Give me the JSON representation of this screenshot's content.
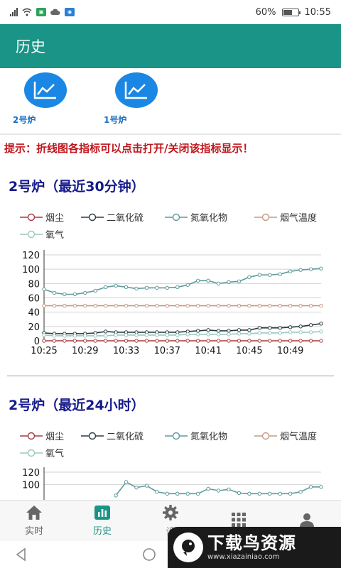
{
  "status_bar": {
    "battery_percent": "60%",
    "time": "10:55",
    "battery_level": 0.6
  },
  "header": {
    "title": "历史"
  },
  "furnaces": [
    {
      "label": "2号炉",
      "icon": "line-chart-icon"
    },
    {
      "label": "1号炉",
      "icon": "line-chart-icon"
    }
  ],
  "tip": "提示：折线图各指标可以点击打开/关闭该指标显示！",
  "legend_items": [
    {
      "label": "烟尘",
      "color": "#a63a43"
    },
    {
      "label": "二氧化硫",
      "color": "#2b3a42"
    },
    {
      "label": "氮氧化物",
      "color": "#5f9a9d"
    },
    {
      "label": "烟气温度",
      "color": "#c49a86"
    },
    {
      "label": "氧气",
      "color": "#9cc8c0"
    }
  ],
  "chart_data": [
    {
      "type": "line",
      "title": "2号炉（最近30分钟）",
      "ylim": [
        0,
        120
      ],
      "yticks": [
        0,
        20,
        40,
        60,
        80,
        100,
        120
      ],
      "x": [
        "10:25",
        "10:26",
        "10:27",
        "10:28",
        "10:29",
        "10:30",
        "10:31",
        "10:32",
        "10:33",
        "10:34",
        "10:35",
        "10:36",
        "10:37",
        "10:38",
        "10:39",
        "10:40",
        "10:41",
        "10:42",
        "10:43",
        "10:44",
        "10:45",
        "10:46",
        "10:47",
        "10:48",
        "10:49",
        "10:50",
        "10:51",
        "10:52"
      ],
      "xtick_labels": [
        "10:25",
        "10:29",
        "10:33",
        "10:37",
        "10:41",
        "10:45",
        "10:49"
      ],
      "grid": true,
      "legend_position": "top",
      "series": [
        {
          "name": "烟尘",
          "color": "#a63a43",
          "values": [
            0,
            0,
            0,
            0,
            0,
            0,
            0,
            0,
            0,
            0,
            0,
            0,
            0,
            0,
            0,
            0,
            0,
            0,
            0,
            0,
            0,
            0,
            0,
            0,
            0,
            0,
            0,
            0
          ]
        },
        {
          "name": "二氧化硫",
          "color": "#2b3a42",
          "values": [
            11,
            10,
            10,
            10,
            10,
            11,
            13,
            12,
            12,
            12,
            12,
            12,
            12,
            12,
            13,
            14,
            15,
            14,
            14,
            15,
            15,
            18,
            18,
            18,
            19,
            20,
            22,
            24
          ]
        },
        {
          "name": "氮氧化物",
          "color": "#5f9a9d",
          "values": [
            72,
            67,
            65,
            65,
            67,
            70,
            75,
            77,
            75,
            73,
            74,
            74,
            74,
            75,
            78,
            84,
            84,
            80,
            82,
            83,
            89,
            92,
            92,
            93,
            97,
            99,
            100,
            101
          ]
        },
        {
          "name": "烟气温度",
          "color": "#c49a86",
          "values": [
            49,
            49,
            49,
            49,
            49,
            49,
            49,
            49,
            49,
            49,
            49,
            49,
            49,
            49,
            49,
            49,
            49,
            49,
            49,
            49,
            49,
            49,
            49,
            49,
            49,
            49,
            49,
            49
          ]
        },
        {
          "name": "氧气",
          "color": "#9cc8c0",
          "values": [
            8,
            7,
            7,
            7,
            7,
            7,
            7,
            8,
            8,
            8,
            8,
            8,
            8,
            8,
            9,
            9,
            9,
            9,
            9,
            10,
            10,
            11,
            11,
            11,
            12,
            12,
            12,
            13
          ]
        }
      ]
    },
    {
      "type": "line",
      "title": "2号炉（最近24小时）",
      "ylim": [
        0,
        120
      ],
      "yticks": [
        100,
        120
      ],
      "grid": true,
      "legend_position": "top",
      "series": [
        {
          "name": "氮氧化物",
          "color": "#5f9a9d",
          "values": [
            null,
            null,
            null,
            null,
            null,
            null,
            null,
            82,
            104,
            95,
            98,
            88,
            85,
            85,
            85,
            85,
            93,
            90,
            92,
            86,
            85,
            85,
            85,
            85,
            85,
            88,
            96,
            96
          ]
        }
      ]
    }
  ],
  "nav": [
    {
      "label": "实时",
      "icon": "home-icon",
      "active": false
    },
    {
      "label": "历史",
      "icon": "bar-chart-icon",
      "active": true
    },
    {
      "label": "设",
      "icon": "gear-icon",
      "active": false
    },
    {
      "label": "",
      "icon": "grid-icon",
      "active": false
    },
    {
      "label": "",
      "icon": "person-icon",
      "active": false
    }
  ],
  "watermark": {
    "title": "下载鸟资源",
    "url": "www.xiazainiao.com"
  }
}
